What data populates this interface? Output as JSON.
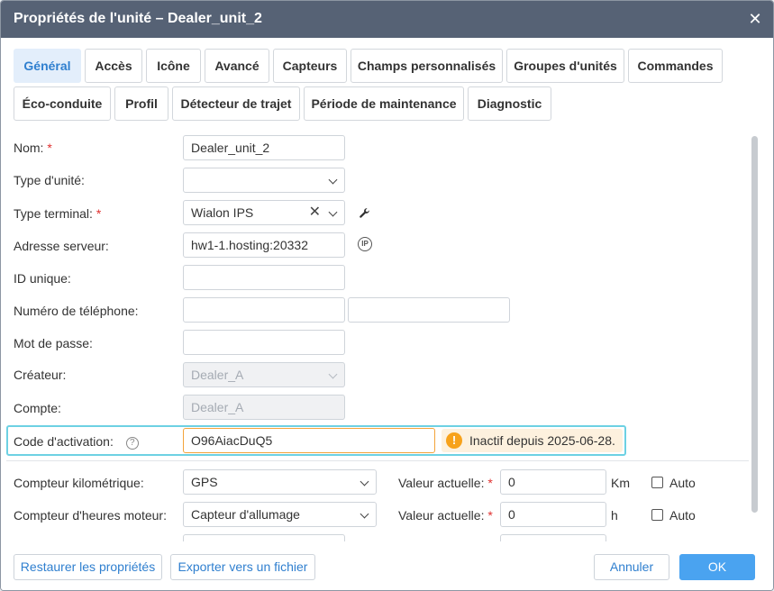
{
  "dialog": {
    "title": "Propriétés de l'unité – Dealer_unit_2",
    "close_glyph": "✕"
  },
  "tabs": [
    {
      "label": "Général",
      "active": true
    },
    {
      "label": "Accès"
    },
    {
      "label": "Icône"
    },
    {
      "label": "Avancé"
    },
    {
      "label": "Capteurs"
    },
    {
      "label": "Champs personnalisés"
    },
    {
      "label": "Groupes d'unités"
    },
    {
      "label": "Commandes"
    },
    {
      "label": "Éco-conduite"
    },
    {
      "label": "Profil"
    },
    {
      "label": "Détecteur de trajet"
    },
    {
      "label": "Période de maintenance"
    },
    {
      "label": "Diagnostic"
    }
  ],
  "form": {
    "name_label": "Nom:",
    "name_value": "Dealer_unit_2",
    "unit_type_label": "Type d'unité:",
    "unit_type_value": "",
    "terminal_label": "Type terminal:",
    "terminal_value": "Wialon IPS",
    "server_label": "Adresse serveur:",
    "server_value": "hw1-1.hosting:20332",
    "ip_icon_text": "IP",
    "uid_label": "ID unique:",
    "uid_value": "",
    "phone_label": "Numéro de téléphone:",
    "phone_value": "",
    "phone_value2": "",
    "password_label": "Mot de passe:",
    "password_value": "",
    "creator_label": "Créateur:",
    "creator_value": "Dealer_A",
    "account_label": "Compte:",
    "account_value": "Dealer_A",
    "activation_label": "Code d'activation:",
    "activation_help": "?",
    "activation_value": "O96AiacDuQ5",
    "activation_warning": "Inactif depuis 2025-06-28.",
    "required_mark": "*"
  },
  "counters": {
    "mileage_label": "Compteur kilométrique:",
    "mileage_value": "GPS",
    "mileage_current_label": "Valeur actuelle:",
    "mileage_current_value": "0",
    "mileage_unit": "Km",
    "mileage_auto": "Auto",
    "engine_label": "Compteur d'heures moteur:",
    "engine_value": "Capteur d'allumage",
    "engine_current_label": "Valeur actuelle:",
    "engine_current_value": "0",
    "engine_unit": "h",
    "engine_auto": "Auto"
  },
  "footer": {
    "restore_label": "Restaurer les propriétés",
    "export_label": "Exporter vers un fichier",
    "cancel_label": "Annuler",
    "ok_label": "OK"
  },
  "colors": {
    "titlebar": "#566275",
    "accent": "#2f7fcf",
    "primary_button": "#4aa3f0",
    "warning": "#f7a21b",
    "required": "#e0302f"
  }
}
